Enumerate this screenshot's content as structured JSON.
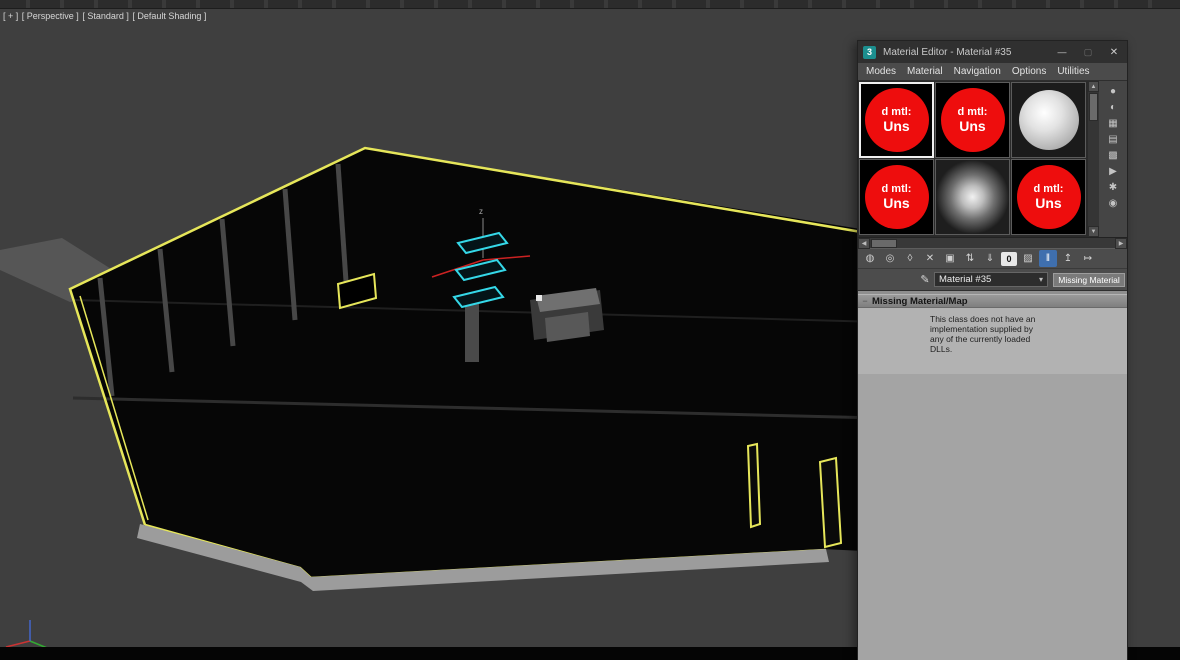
{
  "viewport": {
    "labels": [
      "[ + ]",
      "[ Perspective ]",
      "[ Standard ]",
      "[ Default Shading ]"
    ]
  },
  "material_editor": {
    "window": {
      "icon_glyph": "3",
      "title": "Material Editor - Material #35",
      "minimize_glyph": "—",
      "maximize_glyph": "▢",
      "close_glyph": "✕"
    },
    "menus": [
      "Modes",
      "Material",
      "Navigation",
      "Options",
      "Utilities"
    ],
    "slots": [
      {
        "kind": "missing-material",
        "line1": "d mtl:",
        "line2": "Uns"
      },
      {
        "kind": "missing-material",
        "line1": "d mtl:",
        "line2": "Uns"
      },
      {
        "kind": "sphere-preview"
      },
      {
        "kind": "missing-material",
        "line1": "d mtl:",
        "line2": "Uns"
      },
      {
        "kind": "falloff-preview"
      },
      {
        "kind": "missing-material",
        "line1": "d mtl:",
        "line2": "Uns"
      }
    ],
    "side_tools": {
      "scroll_up": "▲",
      "scroll_down": "▼",
      "icons": [
        {
          "name": "sample-type",
          "glyph": "●"
        },
        {
          "name": "backlight",
          "glyph": "◐"
        },
        {
          "name": "background",
          "glyph": "▦"
        },
        {
          "name": "sample-uv-tiling",
          "glyph": "▤"
        },
        {
          "name": "video-color-check",
          "glyph": "▩"
        },
        {
          "name": "make-preview",
          "glyph": "▶"
        },
        {
          "name": "options",
          "glyph": "✱"
        },
        {
          "name": "select-by-material",
          "glyph": "◉"
        }
      ]
    },
    "h_scroll": {
      "left": "◀",
      "right": "▶"
    },
    "toolbar": [
      {
        "name": "get-material",
        "glyph": "◍"
      },
      {
        "name": "put-material-to-scene",
        "glyph": "◎"
      },
      {
        "name": "assign-material-to-selection",
        "glyph": "◊"
      },
      {
        "name": "reset-map",
        "glyph": "✕"
      },
      {
        "name": "make-material-copy",
        "glyph": "▣"
      },
      {
        "name": "make-unique",
        "glyph": "⇅"
      },
      {
        "name": "put-to-library",
        "glyph": "⇓"
      },
      {
        "name": "material-id-channel",
        "glyph": "0"
      },
      {
        "name": "show-shaded-material-in-viewport",
        "glyph": "▨"
      },
      {
        "name": "show-end-result",
        "glyph": "‖"
      },
      {
        "name": "go-to-parent",
        "glyph": "↥"
      },
      {
        "name": "go-forward-to-sibling",
        "glyph": "↦"
      }
    ],
    "name_row": {
      "eyedropper_glyph": "✎",
      "material_name": "Material #35",
      "dropdown_caret": "▾",
      "type_button": "Missing Material"
    },
    "rollout": {
      "collapse_marker": "−",
      "title": "Missing Material/Map",
      "body_lines": [
        "This class does not have an",
        "implementation supplied by",
        "any of the currently loaded",
        "DLLs."
      ]
    }
  },
  "colors": {
    "selection_cyan": "#35d8e8",
    "outline_yellow": "#e6e65a",
    "missing_red": "#ee0d0d",
    "active_toggle": "#3f6fae"
  }
}
